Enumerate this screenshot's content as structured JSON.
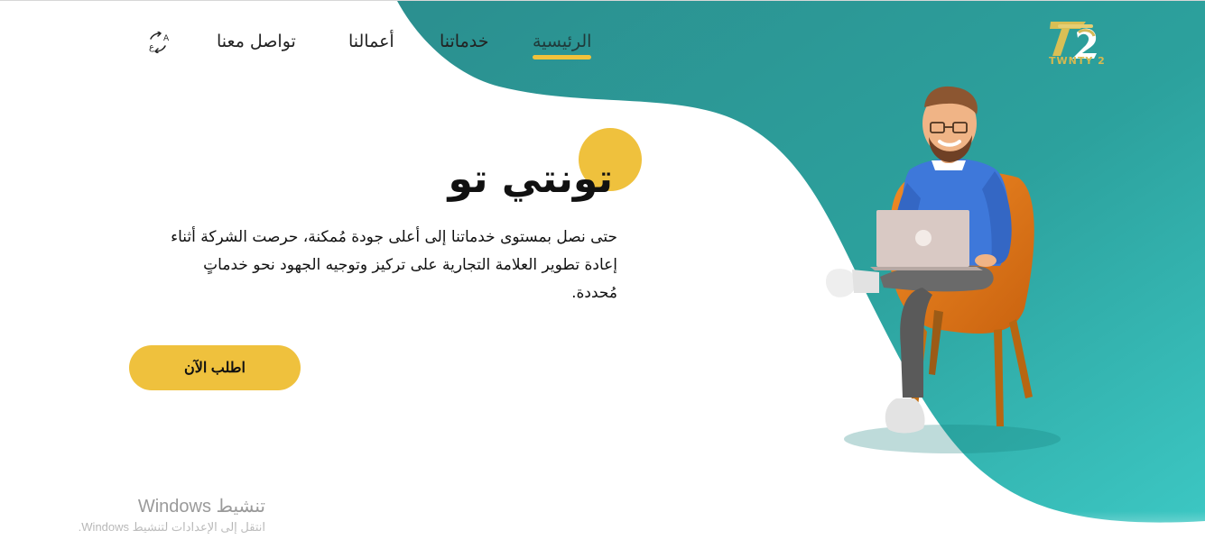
{
  "brand": {
    "logo_mark": "T2",
    "name": "TWNTY 2",
    "accent": "#efc13d",
    "teal": "#2e9a96",
    "teal_light": "#39c6c2"
  },
  "nav": {
    "home": "الرئيسية",
    "services": "خدماتنا",
    "works": "أعمالنا",
    "contact": "تواصل معنا",
    "language_icon": "language-icon"
  },
  "hero": {
    "title": "تونتي تو",
    "description": "حتى نصل بمستوى خدماتنا إلى أعلى جودة مُمكنة، حرصت الشركة أثناء إعادة تطوير العلامة التجارية على تركيز وتوجيه الجهود نحو خدماتٍ مُحددة.",
    "cta": "اطلب الآن"
  },
  "watermark": {
    "title": "تنشيط Windows",
    "subtitle": "انتقل إلى الإعدادات لتنشيط Windows."
  }
}
